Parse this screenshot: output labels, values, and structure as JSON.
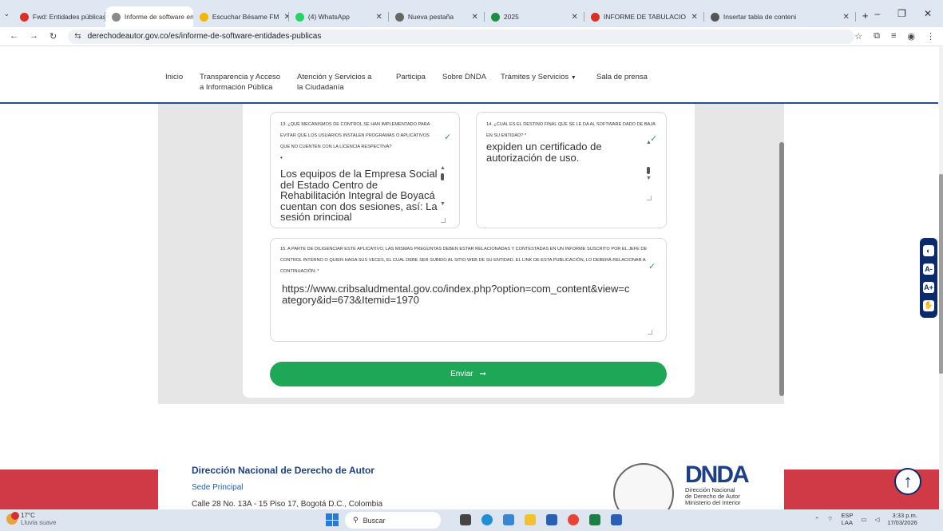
{
  "browser": {
    "tabs": [
      {
        "title": "Fwd: Entidades públicas c",
        "icon": "gmail-icon",
        "color": "#d93025"
      },
      {
        "title": "Informe de software entid",
        "icon": "site-icon",
        "color": "#8a8a8a"
      },
      {
        "title": "Escuchar Bésame FM",
        "icon": "radio-icon",
        "color": "#f2b705"
      },
      {
        "title": "(4) WhatsApp",
        "icon": "whatsapp-icon",
        "color": "#25d366"
      },
      {
        "title": "Nueva pestaña",
        "icon": "chrome-icon",
        "color": "#666666"
      },
      {
        "title": "2025",
        "icon": "sheets-icon",
        "color": "#1e8e3e"
      },
      {
        "title": "INFORME DE TABULACIO",
        "icon": "pdf-icon",
        "color": "#d93025"
      },
      {
        "title": "Insertar tabla de conteni",
        "icon": "site-icon",
        "color": "#555555"
      }
    ],
    "url": "derechodeautor.gov.co/es/informe-de-software-entidades-publicas"
  },
  "nav": {
    "items": [
      {
        "label": "Inicio"
      },
      {
        "label": "Transparencia y Acceso\na Información Pública"
      },
      {
        "label": "Atención y Servicios a\nla Ciudadanía"
      },
      {
        "label": "Participa"
      },
      {
        "label": "Sobre DNDA"
      },
      {
        "label": "Trámites y Servicios"
      },
      {
        "label": "Sala de prensa"
      }
    ]
  },
  "form": {
    "q13": {
      "title": "13. ¿Qué mecanismos de control se han implementado para evitar que los usuarios instalen programas o aplicativos que no cuenten con la licencia respectiva?",
      "answer": "Los equipos de la Empresa Social del Estado Centro de Rehabilitación Integral de Boyacá cuentan con dos sesiones, así: La sesión principal"
    },
    "q14": {
      "title": "14. ¿Cuál es el destino final que se le da al software dado de baja en su entidad? *",
      "answer": "expiden un certificado de autorización de uso."
    },
    "q15": {
      "title": "15. A parte de diligenciar este aplicativo, las mismas preguntas deben estar relacionadas y contestadas en un informe suscrito por el jefe de control interno o quien haga sus veces, el cual debe ser subido al sitio web de su entidad. El link de esta publicación, lo deberá relacionar a continuación: *",
      "answer": "https://www.cribsaludmental.gov.co/index.php?option=com_content&view=category&id=673&Itemid=1970"
    },
    "submit_label": "Enviar"
  },
  "footer": {
    "title": "Dirección Nacional de Derecho de Autor",
    "sede": "Sede Principal",
    "address": "Calle 28 No. 13A - 15 Piso 17, Bogotá D.C., Colombia",
    "logo_text": "DNDA",
    "logo_sub1": "Dirección Nacional",
    "logo_sub2": "de Derecho de Autor",
    "logo_sub3": "Ministerio del Interior"
  },
  "taskbar": {
    "temp": "17°C",
    "weather": "Lluvia suave",
    "search_placeholder": "Buscar",
    "lang1": "ESP",
    "lang2": "LAA",
    "time": "3:33 p.m.",
    "date": "17/03/2026"
  }
}
